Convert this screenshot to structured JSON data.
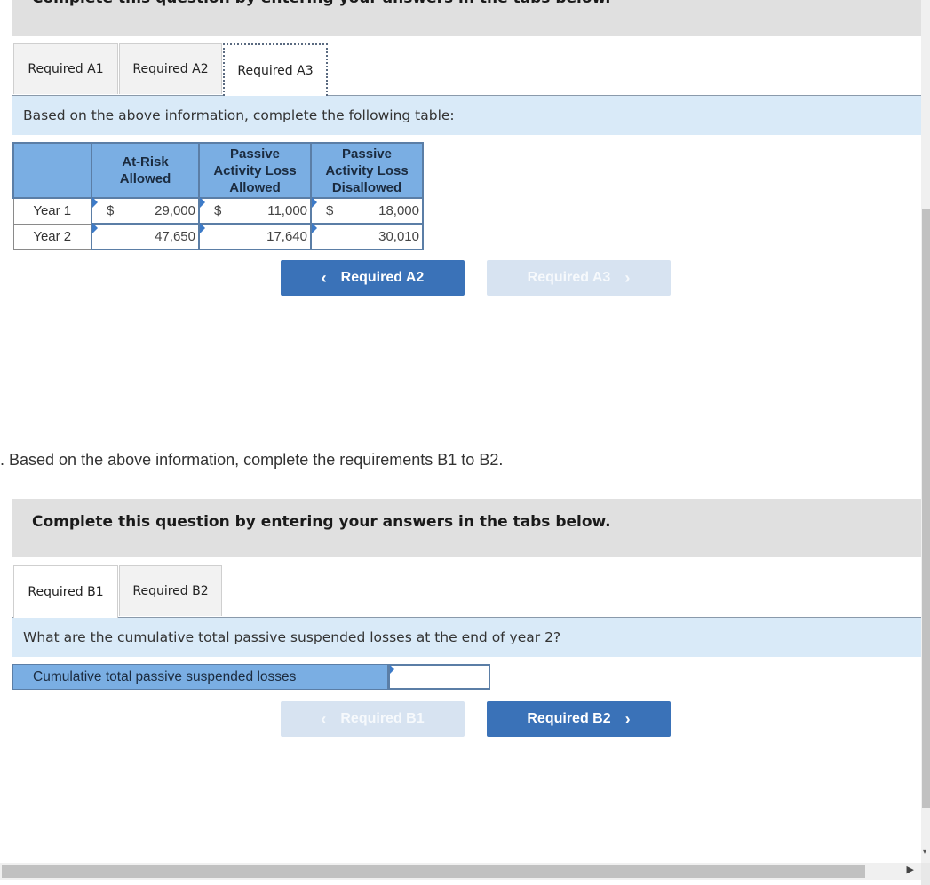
{
  "section_a": {
    "instruction": "Complete this question by entering your answers in the tabs below.",
    "tabs": [
      {
        "label": "Required A1",
        "active": false
      },
      {
        "label": "Required A2",
        "active": false
      },
      {
        "label": "Required A3",
        "active": true
      }
    ],
    "prompt": "Based on the above information, complete the following table:",
    "table": {
      "headers": [
        "",
        "At-Risk Allowed",
        "Passive Activity Loss Allowed",
        "Passive Activity Loss Disallowed"
      ],
      "header_lines": [
        [
          ""
        ],
        [
          "At-Risk",
          "Allowed"
        ],
        [
          "Passive",
          "Activity Loss",
          "Allowed"
        ],
        [
          "Passive",
          "Activity Loss",
          "Disallowed"
        ]
      ],
      "rows": [
        {
          "label": "Year 1",
          "cells": [
            {
              "currency": "$",
              "value": "29,000"
            },
            {
              "currency": "$",
              "value": "11,000"
            },
            {
              "currency": "$",
              "value": "18,000"
            }
          ]
        },
        {
          "label": "Year 2",
          "cells": [
            {
              "currency": "",
              "value": "47,650"
            },
            {
              "currency": "",
              "value": "17,640"
            },
            {
              "currency": "",
              "value": "30,010"
            }
          ]
        }
      ]
    },
    "nav": {
      "prev": {
        "label": "Required A2",
        "chevron": "‹",
        "enabled": true
      },
      "next": {
        "label": "Required A3",
        "chevron": "›",
        "enabled": false
      }
    }
  },
  "section_b": {
    "intro": ". Based on the above information, complete the requirements B1 to B2.",
    "instruction": "Complete this question by entering your answers in the tabs below.",
    "tabs": [
      {
        "label": "Required B1",
        "active": true
      },
      {
        "label": "Required B2",
        "active": false
      }
    ],
    "prompt": "What are the cumulative total passive suspended losses at the end of year 2?",
    "answer": {
      "label": "Cumulative total passive suspended losses",
      "value": ""
    },
    "nav": {
      "prev": {
        "label": "Required B1",
        "chevron": "‹",
        "enabled": false
      },
      "next": {
        "label": "Required B2",
        "chevron": "›",
        "enabled": true
      }
    }
  },
  "scrollbars": {
    "down_arrow": "▾",
    "right_arrow": "▶"
  },
  "colors": {
    "header_blue": "#7aaee3",
    "button_blue": "#3a72b8",
    "button_disabled": "#d7e3f1",
    "prompt_bg": "#d9eaf8",
    "instruction_bg": "#e0e0e0"
  }
}
